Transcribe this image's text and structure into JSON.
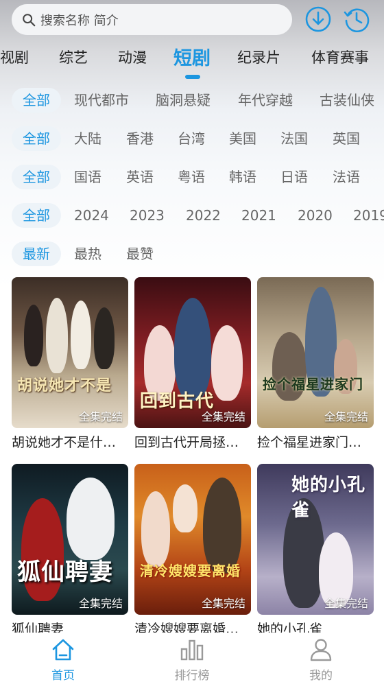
{
  "search": {
    "placeholder": "搜索名称 简介"
  },
  "header_icons": {
    "download": "download-icon",
    "history": "history-icon"
  },
  "category_tabs": [
    {
      "label": "视剧"
    },
    {
      "label": "综艺"
    },
    {
      "label": "动漫"
    },
    {
      "label": "短剧",
      "active": true
    },
    {
      "label": "纪录片"
    },
    {
      "label": "体育赛事"
    }
  ],
  "filters": {
    "genre": [
      "全部",
      "现代都市",
      "脑洞悬疑",
      "年代穿越",
      "古装仙侠"
    ],
    "region": [
      "全部",
      "大陆",
      "香港",
      "台湾",
      "美国",
      "法国",
      "英国"
    ],
    "language": [
      "全部",
      "国语",
      "英语",
      "粤语",
      "韩语",
      "日语",
      "法语"
    ],
    "year": [
      "全部",
      "2024",
      "2023",
      "2022",
      "2021",
      "2020",
      "2019"
    ],
    "sort": [
      "最新",
      "最热",
      "最赞"
    ]
  },
  "items": [
    {
      "title": "胡说她才不是什…",
      "badge": "全集完结",
      "poster_text": "胡说她才不是"
    },
    {
      "title": "回到古代开局拯…",
      "badge": "全集完结",
      "poster_text": "回到古代"
    },
    {
      "title": "捡个福星进家门…",
      "badge": "全集完结",
      "poster_text": "捡个福星进家门"
    },
    {
      "title": "狐仙聘妻",
      "badge": "全集完结",
      "poster_text": "狐仙聘妻"
    },
    {
      "title": "清冷嫂嫂要离婚…",
      "badge": "全集完结",
      "poster_text": "清冷嫂嫂要离婚"
    },
    {
      "title": "她的小孔雀",
      "badge": "全集完结",
      "poster_text": "她的小孔雀"
    }
  ],
  "bottom_nav": [
    {
      "label": "首页",
      "icon": "home-icon",
      "active": true
    },
    {
      "label": "排行榜",
      "icon": "ranking-icon"
    },
    {
      "label": "我的",
      "icon": "profile-icon"
    }
  ],
  "colors": {
    "accent": "#1c96e0",
    "chip_bg": "#edf3f8",
    "text_muted": "#666666"
  }
}
